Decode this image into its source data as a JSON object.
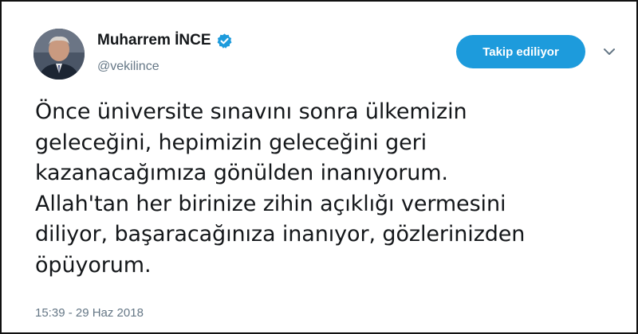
{
  "tweet": {
    "display_name": "Muharrem İNCE",
    "handle": "@vekilince",
    "verified_icon": "verified-badge-icon",
    "follow_label": "Takip ediliyor",
    "menu_icon": "chevron-down-icon",
    "text": "Önce üniversite sınavını sonra ülkemizin\ngeleceğini, hepimizin geleceğini geri\nkazanacağımıza gönülden inanıyorum.\nAllah'tan her birinize zihin açıklığı vermesini\ndiliyor, başaracağınıza inanıyor, gözlerinizden\nöpüyorum.",
    "timestamp": "15:39 - 29 Haz 2018"
  },
  "colors": {
    "accent": "#1d9bdc",
    "text": "#14171a",
    "secondary_text": "#657786"
  }
}
